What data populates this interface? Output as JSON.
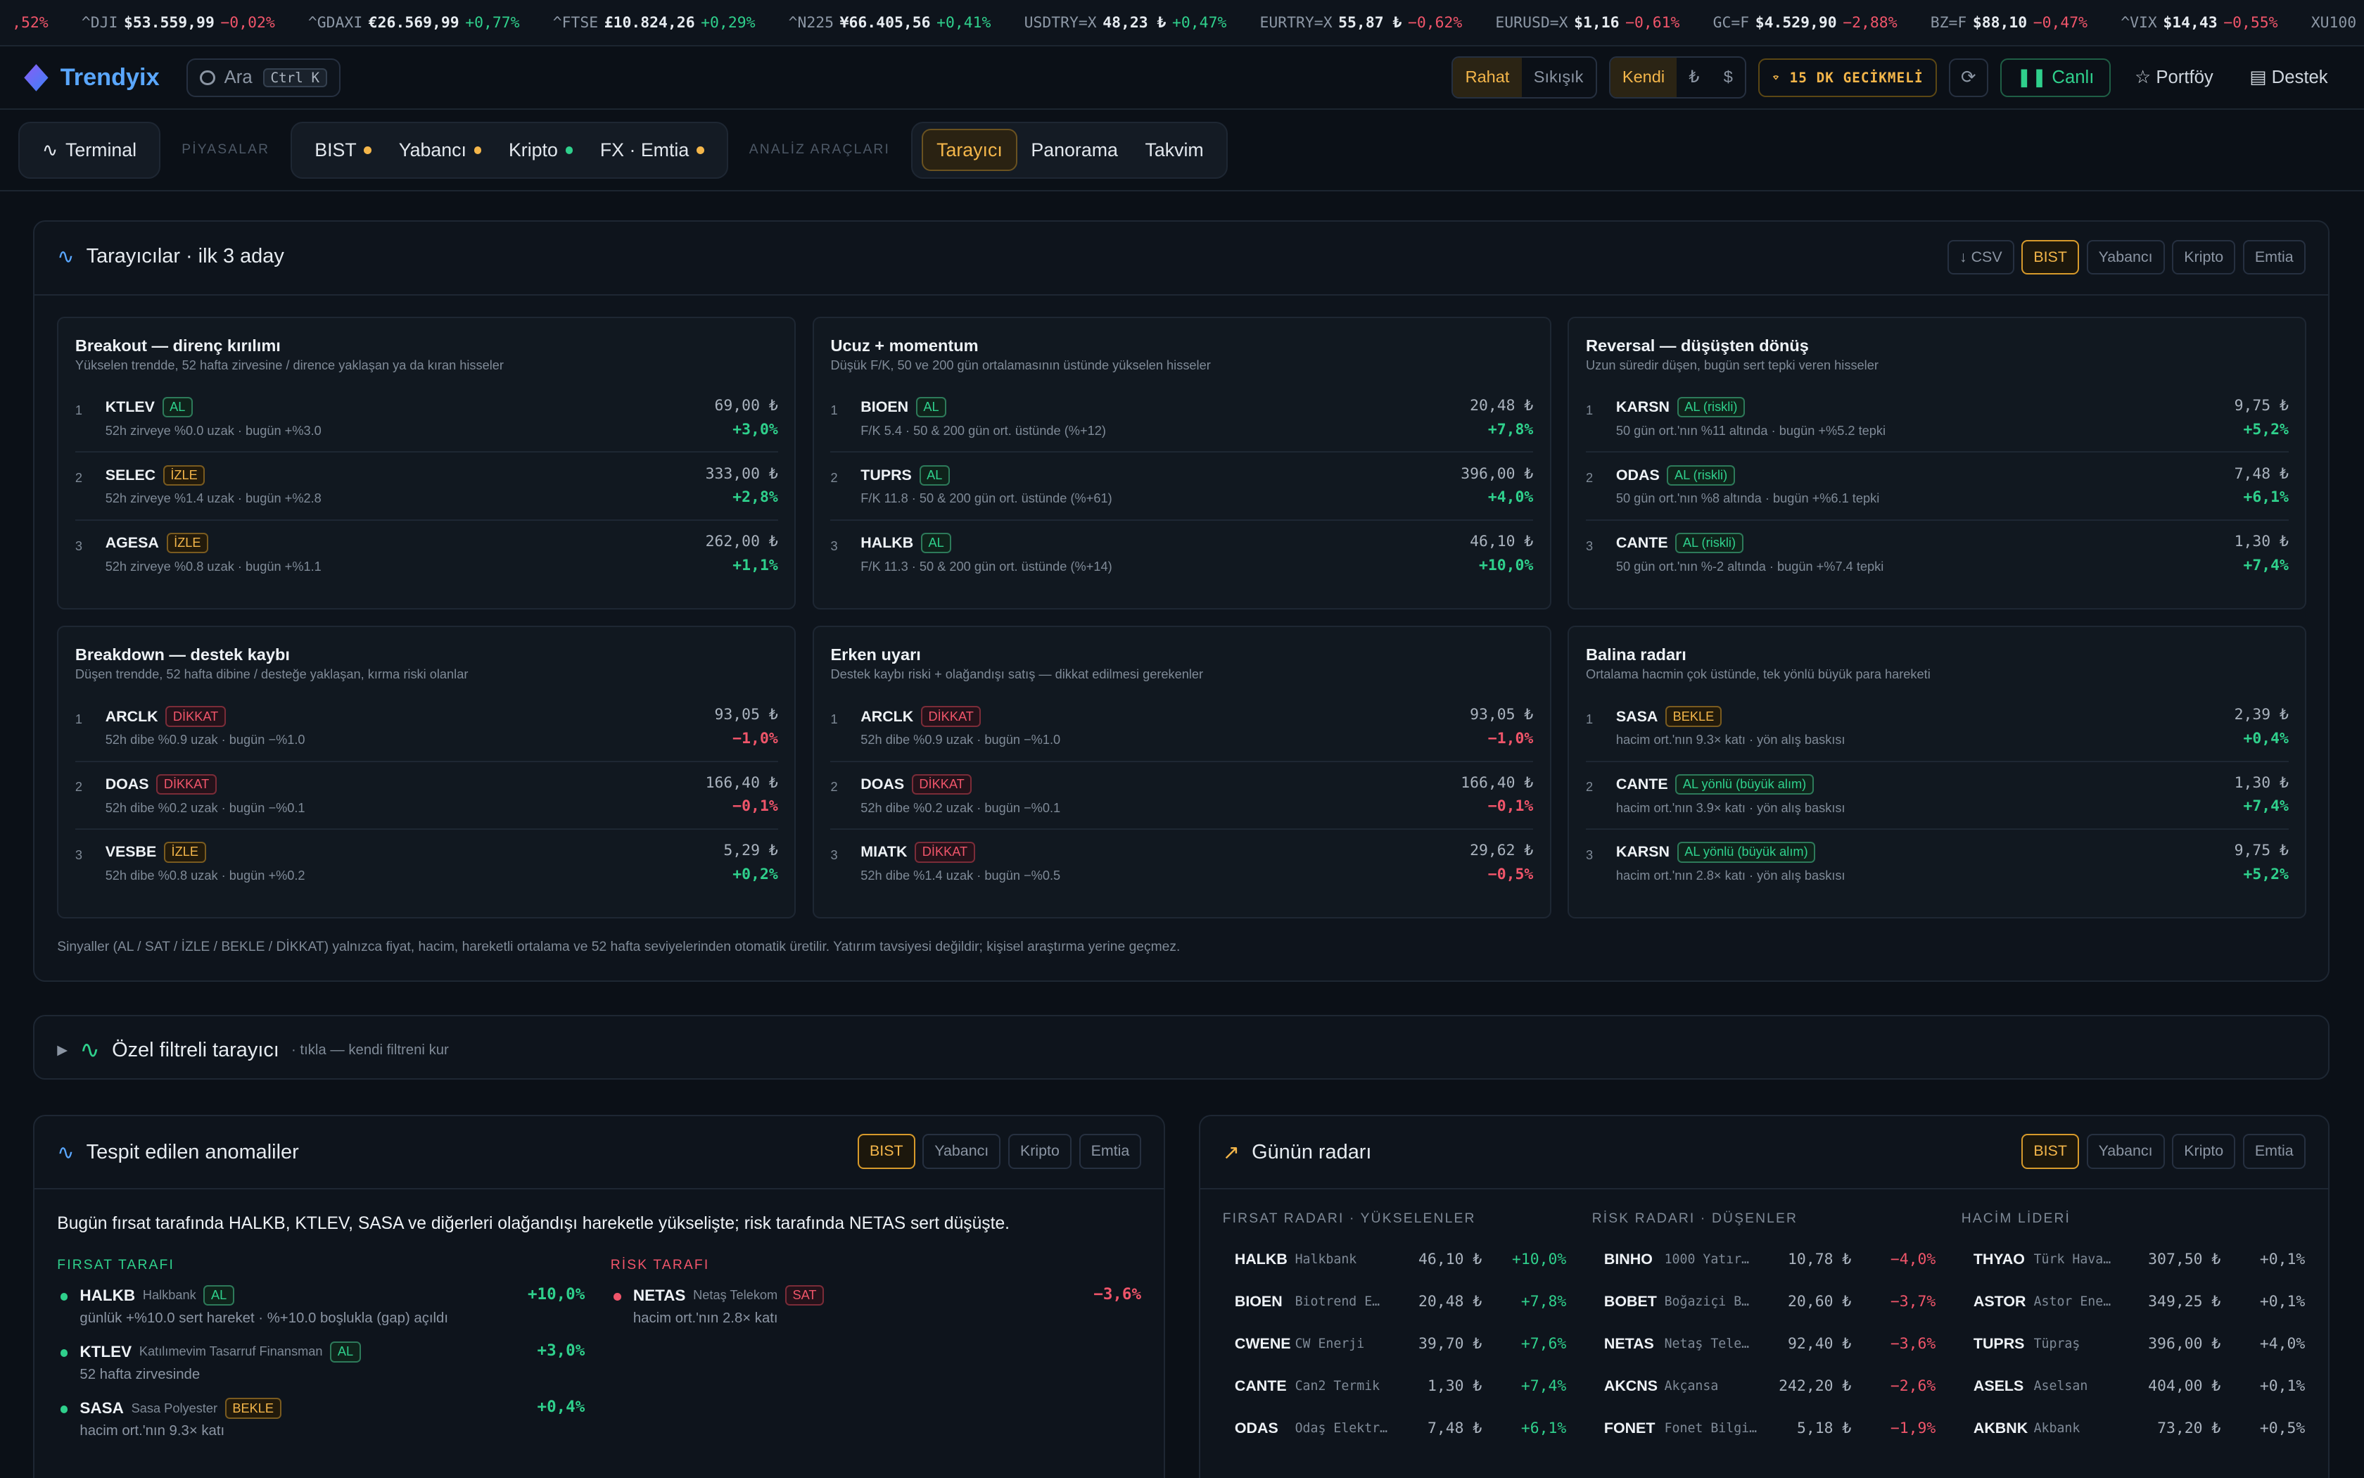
{
  "ticker": [
    {
      "sym": "",
      "val": "",
      "chg": ",52%",
      "dir": "down"
    },
    {
      "sym": "^DJI",
      "val": "$53.559,99",
      "chg": "−0,02%",
      "dir": "down"
    },
    {
      "sym": "^GDAXI",
      "val": "€26.569,99",
      "chg": "+0,77%",
      "dir": "up"
    },
    {
      "sym": "^FTSE",
      "val": "£10.824,26",
      "chg": "+0,29%",
      "dir": "up"
    },
    {
      "sym": "^N225",
      "val": "¥66.405,56",
      "chg": "+0,41%",
      "dir": "up"
    },
    {
      "sym": "USDTRY=X",
      "val": "48,23 ₺",
      "chg": "+0,47%",
      "dir": "up"
    },
    {
      "sym": "EURTRY=X",
      "val": "55,87 ₺",
      "chg": "−0,62%",
      "dir": "down"
    },
    {
      "sym": "EURUSD=X",
      "val": "$1,16",
      "chg": "−0,61%",
      "dir": "down"
    },
    {
      "sym": "GC=F",
      "val": "$4.529,90",
      "chg": "−2,88%",
      "dir": "down"
    },
    {
      "sym": "BZ=F",
      "val": "$88,10",
      "chg": "−0,47%",
      "dir": "down"
    },
    {
      "sym": "^VIX",
      "val": "$14,43",
      "chg": "−0,55%",
      "dir": "down"
    },
    {
      "sym": "XU100",
      "val": "",
      "chg": "",
      "dir": "up"
    }
  ],
  "header": {
    "brand": "Trendyix",
    "search_placeholder": "Ara",
    "search_kbd": "Ctrl K",
    "density": [
      "Rahat",
      "Sıkışık"
    ],
    "currency": [
      "Kendi",
      "₺",
      "$"
    ],
    "delay": "15 DK GECİKMELİ",
    "live": "Canlı",
    "portfolio": "Portföy",
    "support": "Destek"
  },
  "nav": {
    "terminal": "Terminal",
    "markets_label": "PİYASALAR",
    "markets": [
      {
        "label": "BIST",
        "dot": "#f4b64a"
      },
      {
        "label": "Yabancı",
        "dot": "#f4b64a"
      },
      {
        "label": "Kripto",
        "dot": "#2fd08c"
      },
      {
        "label": "FX · Emtia",
        "dot": "#f4b64a"
      }
    ],
    "tools_label": "ANALİZ ARAÇLARI",
    "tools": [
      "Tarayıcı",
      "Panorama",
      "Takvim"
    ]
  },
  "screeners": {
    "title": "Tarayıcılar · ilk 3 aday",
    "csv": "↓ CSV",
    "tabs": [
      "BIST",
      "Yabancı",
      "Kripto",
      "Emtia"
    ],
    "footnote": "Sinyaller (AL / SAT / İZLE / BEKLE / DİKKAT) yalnızca fiyat, hacim, hareketli ortalama ve 52 hafta seviyelerinden otomatik üretilir. Yatırım tavsiyesi değildir; kişisel araştırma yerine geçmez.",
    "cards": [
      {
        "title": "Breakout — direnç kırılımı",
        "sub": "Yükselen trendde, 52 hafta zirvesine / dirence yaklaşan ya da kıran hisseler",
        "rows": [
          {
            "rank": "1",
            "sym": "KTLEV",
            "badge": "AL",
            "cls": "b-al",
            "det": "52h zirveye %0.0 uzak · bugün +%3.0",
            "price": "69,00 ₺",
            "chg": "+3,0%",
            "dir": "up"
          },
          {
            "rank": "2",
            "sym": "SELEC",
            "badge": "İZLE",
            "cls": "b-izle",
            "det": "52h zirveye %1.4 uzak · bugün +%2.8",
            "price": "333,00 ₺",
            "chg": "+2,8%",
            "dir": "up"
          },
          {
            "rank": "3",
            "sym": "AGESA",
            "badge": "İZLE",
            "cls": "b-izle",
            "det": "52h zirveye %0.8 uzak · bugün +%1.1",
            "price": "262,00 ₺",
            "chg": "+1,1%",
            "dir": "up"
          }
        ]
      },
      {
        "title": "Ucuz + momentum",
        "sub": "Düşük F/K, 50 ve 200 gün ortalamasının üstünde yükselen hisseler",
        "rows": [
          {
            "rank": "1",
            "sym": "BIOEN",
            "badge": "AL",
            "cls": "b-al",
            "det": "F/K 5.4 · 50 & 200 gün ort. üstünde (%+12)",
            "price": "20,48 ₺",
            "chg": "+7,8%",
            "dir": "up"
          },
          {
            "rank": "2",
            "sym": "TUPRS",
            "badge": "AL",
            "cls": "b-al",
            "det": "F/K 11.8 · 50 & 200 gün ort. üstünde (%+61)",
            "price": "396,00 ₺",
            "chg": "+4,0%",
            "dir": "up"
          },
          {
            "rank": "3",
            "sym": "HALKB",
            "badge": "AL",
            "cls": "b-al",
            "det": "F/K 11.3 · 50 & 200 gün ort. üstünde (%+14)",
            "price": "46,10 ₺",
            "chg": "+10,0%",
            "dir": "up"
          }
        ]
      },
      {
        "title": "Reversal — düşüşten dönüş",
        "sub": "Uzun süredir düşen, bugün sert tepki veren hisseler",
        "rows": [
          {
            "rank": "1",
            "sym": "KARSN",
            "badge": "AL (riskli)",
            "cls": "b-al",
            "det": "50 gün ort.'nın %11 altında · bugün +%5.2 tepki",
            "price": "9,75 ₺",
            "chg": "+5,2%",
            "dir": "up"
          },
          {
            "rank": "2",
            "sym": "ODAS",
            "badge": "AL (riskli)",
            "cls": "b-al",
            "det": "50 gün ort.'nın %8 altında · bugün +%6.1 tepki",
            "price": "7,48 ₺",
            "chg": "+6,1%",
            "dir": "up"
          },
          {
            "rank": "3",
            "sym": "CANTE",
            "badge": "AL (riskli)",
            "cls": "b-al",
            "det": "50 gün ort.'nın %-2 altında · bugün +%7.4 tepki",
            "price": "1,30 ₺",
            "chg": "+7,4%",
            "dir": "up"
          }
        ]
      },
      {
        "title": "Breakdown — destek kaybı",
        "sub": "Düşen trendde, 52 hafta dibine / desteğe yaklaşan, kırma riski olanlar",
        "rows": [
          {
            "rank": "1",
            "sym": "ARCLK",
            "badge": "DİKKAT",
            "cls": "b-dik",
            "det": "52h dibe %0.9 uzak · bugün −%1.0",
            "price": "93,05 ₺",
            "chg": "−1,0%",
            "dir": "down"
          },
          {
            "rank": "2",
            "sym": "DOAS",
            "badge": "DİKKAT",
            "cls": "b-dik",
            "det": "52h dibe %0.2 uzak · bugün −%0.1",
            "price": "166,40 ₺",
            "chg": "−0,1%",
            "dir": "down"
          },
          {
            "rank": "3",
            "sym": "VESBE",
            "badge": "İZLE",
            "cls": "b-izle",
            "det": "52h dibe %0.8 uzak · bugün +%0.2",
            "price": "5,29 ₺",
            "chg": "+0,2%",
            "dir": "up"
          }
        ]
      },
      {
        "title": "Erken uyarı",
        "sub": "Destek kaybı riski + olağandışı satış — dikkat edilmesi gerekenler",
        "rows": [
          {
            "rank": "1",
            "sym": "ARCLK",
            "badge": "DİKKAT",
            "cls": "b-dik",
            "det": "52h dibe %0.9 uzak · bugün −%1.0",
            "price": "93,05 ₺",
            "chg": "−1,0%",
            "dir": "down"
          },
          {
            "rank": "2",
            "sym": "DOAS",
            "badge": "DİKKAT",
            "cls": "b-dik",
            "det": "52h dibe %0.2 uzak · bugün −%0.1",
            "price": "166,40 ₺",
            "chg": "−0,1%",
            "dir": "down"
          },
          {
            "rank": "3",
            "sym": "MIATK",
            "badge": "DİKKAT",
            "cls": "b-dik",
            "det": "52h dibe %1.4 uzak · bugün −%0.5",
            "price": "29,62 ₺",
            "chg": "−0,5%",
            "dir": "down"
          }
        ]
      },
      {
        "title": "Balina radarı",
        "sub": "Ortalama hacmin çok üstünde, tek yönlü büyük para hareketi",
        "rows": [
          {
            "rank": "1",
            "sym": "SASA",
            "badge": "BEKLE",
            "cls": "b-bek",
            "det": "hacim ort.'nın 9.3× katı · yön alış baskısı",
            "price": "2,39 ₺",
            "chg": "+0,4%",
            "dir": "up"
          },
          {
            "rank": "2",
            "sym": "CANTE",
            "badge": "AL yönlü (büyük alım)",
            "cls": "b-al",
            "det": "hacim ort.'nın 3.9× katı · yön alış baskısı",
            "price": "1,30 ₺",
            "chg": "+7,4%",
            "dir": "up"
          },
          {
            "rank": "3",
            "sym": "KARSN",
            "badge": "AL yönlü (büyük alım)",
            "cls": "b-al",
            "det": "hacim ort.'nın 2.8× katı · yön alış baskısı",
            "price": "9,75 ₺",
            "chg": "+5,2%",
            "dir": "up"
          }
        ]
      }
    ]
  },
  "custom": {
    "title": "Özel filtreli tarayıcı",
    "hint": "· tıkla — kendi filtreni kur"
  },
  "anomalies": {
    "title": "Tespit edilen anomaliler",
    "tabs": [
      "BIST",
      "Yabancı",
      "Kripto",
      "Emtia"
    ],
    "summary": "Bugün fırsat tarafında HALKB, KTLEV, SASA ve diğerleri olağandışı hareketle yükselişte; risk tarafında NETAS sert düşüşte.",
    "opp_label": "FIRSAT TARAFI",
    "risk_label": "RİSK TARAFI",
    "opp": [
      {
        "sym": "HALKB",
        "name": "Halkbank",
        "badge": "AL",
        "cls": "b-al",
        "chg": "+10,0%",
        "det": "günlük +%10.0 sert hareket · %+10.0 boşlukla (gap) açıldı"
      },
      {
        "sym": "KTLEV",
        "name": "Katılımevim Tasarruf Finansman",
        "badge": "AL",
        "cls": "b-al",
        "chg": "+3,0%",
        "det": "52 hafta zirvesinde"
      },
      {
        "sym": "SASA",
        "name": "Sasa Polyester",
        "badge": "BEKLE",
        "cls": "b-bek",
        "chg": "+0,4%",
        "det": "hacim ort.'nın 9.3× katı"
      }
    ],
    "risk": [
      {
        "sym": "NETAS",
        "name": "Netaş Telekom",
        "badge": "SAT",
        "cls": "b-sat",
        "chg": "−3,6%",
        "det": "hacim ort.'nın 2.8× katı"
      }
    ]
  },
  "radar": {
    "title": "Günün radarı",
    "tabs": [
      "BIST",
      "Yabancı",
      "Kripto",
      "Emtia"
    ],
    "cols": [
      {
        "label": "FIRSAT RADARI · YÜKSELENLER",
        "rows": [
          {
            "s": "HALKB",
            "n": "Halkbank",
            "p": "46,10 ₺",
            "c": "+10,0%",
            "d": "up"
          },
          {
            "s": "BIOEN",
            "n": "Biotrend E…",
            "p": "20,48 ₺",
            "c": "+7,8%",
            "d": "up"
          },
          {
            "s": "CWENE",
            "n": "CW Enerji",
            "p": "39,70 ₺",
            "c": "+7,6%",
            "d": "up"
          },
          {
            "s": "CANTE",
            "n": "Can2 Termik",
            "p": "1,30 ₺",
            "c": "+7,4%",
            "d": "up"
          },
          {
            "s": "ODAS",
            "n": "Odaş Elektrik",
            "p": "7,48 ₺",
            "c": "+6,1%",
            "d": "up"
          }
        ]
      },
      {
        "label": "RİSK RADARI · DÜŞENLER",
        "rows": [
          {
            "s": "BINHO",
            "n": "1000 Yatır…",
            "p": "10,78 ₺",
            "c": "−4,0%",
            "d": "down"
          },
          {
            "s": "BOBET",
            "n": "Boğaziçi B…",
            "p": "20,60 ₺",
            "c": "−3,7%",
            "d": "down"
          },
          {
            "s": "NETAS",
            "n": "Netaş Tele…",
            "p": "92,40 ₺",
            "c": "−3,6%",
            "d": "down"
          },
          {
            "s": "AKCNS",
            "n": "Akçansa",
            "p": "242,20 ₺",
            "c": "−2,6%",
            "d": "down"
          },
          {
            "s": "FONET",
            "n": "Fonet Bilgi …",
            "p": "5,18 ₺",
            "c": "−1,9%",
            "d": "down"
          }
        ]
      },
      {
        "label": "HACİM LİDERİ",
        "rows": [
          {
            "s": "THYAO",
            "n": "Türk Hava…",
            "p": "307,50 ₺",
            "c": "+0,1%",
            "d": "flat"
          },
          {
            "s": "ASTOR",
            "n": "Astor Ene…",
            "p": "349,25 ₺",
            "c": "+0,1%",
            "d": "flat"
          },
          {
            "s": "TUPRS",
            "n": "Tüpraş",
            "p": "396,00 ₺",
            "c": "+4,0%",
            "d": "flat"
          },
          {
            "s": "ASELS",
            "n": "Aselsan",
            "p": "404,00 ₺",
            "c": "+0,1%",
            "d": "flat"
          },
          {
            "s": "AKBNK",
            "n": "Akbank",
            "p": "73,20 ₺",
            "c": "+0,5%",
            "d": "flat"
          }
        ]
      }
    ]
  }
}
